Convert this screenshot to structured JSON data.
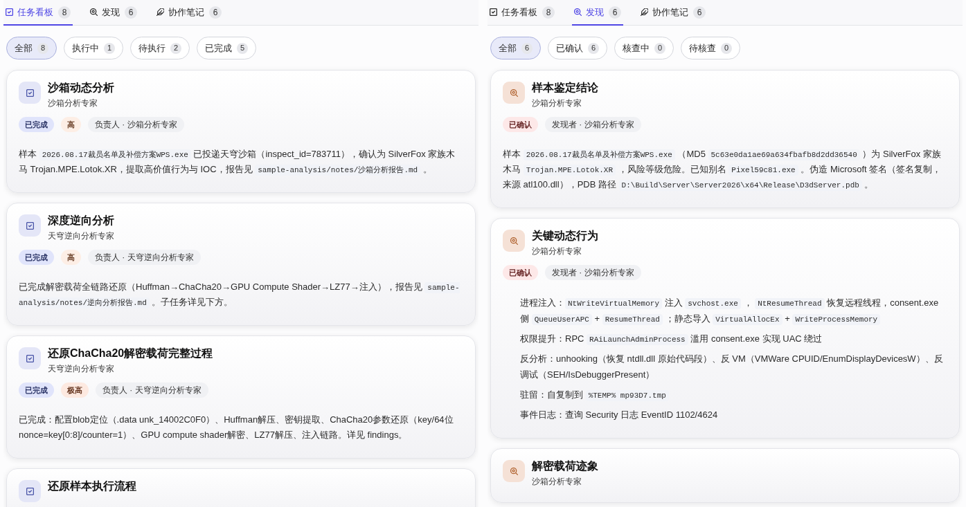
{
  "panels": [
    {
      "tabs": [
        {
          "label": "任务看板",
          "count": "8",
          "selected": true
        },
        {
          "label": "发现",
          "count": "6",
          "selected": false
        },
        {
          "label": "协作笔记",
          "count": "6",
          "selected": false
        }
      ],
      "filters": [
        {
          "label": "全部",
          "count": "8",
          "selected": true
        },
        {
          "label": "执行中",
          "count": "1",
          "selected": false
        },
        {
          "label": "待执行",
          "count": "2",
          "selected": false
        },
        {
          "label": "已完成",
          "count": "5",
          "selected": false
        }
      ],
      "cards": [
        {
          "kind": "task",
          "title": "沙箱动态分析",
          "subtitle": "沙箱分析专家",
          "tags": [
            {
              "kind": "status",
              "text": "已完成",
              "color": "#e0e4fb"
            },
            {
              "kind": "priority",
              "text": "高",
              "color": "#fdeee5"
            },
            {
              "kind": "person",
              "text": "负责人 · 沙箱分析专家"
            }
          ],
          "body": {
            "kind": "paragraph",
            "paragraphs": [
              [
                {
                  "kind": "text",
                  "text": "样本 "
                },
                {
                  "kind": "code",
                  "text": "2026.08.17裁员名单及补偿方案WPS.exe"
                },
                {
                  "kind": "text",
                  "text": " 已投递天穹沙箱（inspect_id=783711），确认为 SilverFox 家族木马 Trojan.MPE.Lotok.XR，提取高价值行为与 IOC，报告见 "
                },
                {
                  "kind": "code",
                  "text": "sample-analysis/notes/沙箱分析报告.md"
                },
                {
                  "kind": "text",
                  "text": " 。"
                }
              ]
            ]
          }
        },
        {
          "kind": "task",
          "title": "深度逆向分析",
          "subtitle": "天穹逆向分析专家",
          "tags": [
            {
              "kind": "status",
              "text": "已完成",
              "color": "#e0e4fb"
            },
            {
              "kind": "priority",
              "text": "高",
              "color": "#fdeee5"
            },
            {
              "kind": "person",
              "text": "负责人 · 天穹逆向分析专家"
            }
          ],
          "body": {
            "kind": "paragraph",
            "paragraphs": [
              [
                {
                  "kind": "text",
                  "text": "已完成解密载荷全链路还原（Huffman→ChaCha20→GPU Compute Shader→LZ77→注入），报告见 "
                },
                {
                  "kind": "code",
                  "text": "sample-analysis/notes/逆向分析报告.md"
                },
                {
                  "kind": "text",
                  "text": " 。子任务详见下方。"
                }
              ]
            ]
          }
        },
        {
          "kind": "task",
          "title": "还原ChaCha20解密载荷完整过程",
          "subtitle": "天穹逆向分析专家",
          "tags": [
            {
              "kind": "status",
              "text": "已完成",
              "color": "#e0e4fb"
            },
            {
              "kind": "priority",
              "text": "极高",
              "color": "#fde9e0"
            },
            {
              "kind": "person",
              "text": "负责人 · 天穹逆向分析专家"
            }
          ],
          "body": {
            "kind": "paragraph",
            "paragraphs": [
              [
                {
                  "kind": "text",
                  "text": "已完成：配置blob定位（.data unk_14002C0F0）、Huffman解压、密钥提取、ChaCha20参数还原（key/64位 nonce=key[0:8]/counter=1）、GPU compute shader解密、LZ77解压、注入链路。详见 findings。"
                }
              ]
            ]
          }
        },
        {
          "kind": "task",
          "title": "还原样本执行流程"
        }
      ]
    },
    {
      "tabs": [
        {
          "label": "任务看板",
          "count": "8",
          "selected": false
        },
        {
          "label": "发现",
          "count": "6",
          "selected": true
        },
        {
          "label": "协作笔记",
          "count": "6",
          "selected": false
        }
      ],
      "filters": [
        {
          "label": "全部",
          "count": "6",
          "selected": true
        },
        {
          "label": "已确认",
          "count": "6",
          "selected": false
        },
        {
          "label": "核查中",
          "count": "0",
          "selected": false
        },
        {
          "label": "待核查",
          "count": "0",
          "selected": false
        }
      ],
      "cards": [
        {
          "kind": "finding",
          "title": "样本鉴定结论",
          "subtitle": "沙箱分析专家",
          "tags": [
            {
              "kind": "status",
              "text": "已确认",
              "color": "#fde8e8"
            },
            {
              "kind": "person",
              "text": "发现者 · 沙箱分析专家"
            }
          ],
          "body": {
            "kind": "paragraph",
            "paragraphs": [
              [
                {
                  "kind": "text",
                  "text": "样本 "
                },
                {
                  "kind": "code",
                  "text": "2026.08.17裁员名单及补偿方案WPS.exe"
                },
                {
                  "kind": "text",
                  "text": " （MD5 "
                },
                {
                  "kind": "code",
                  "text": "5c63e0da1ae69a634fbafb8d2dd36540"
                },
                {
                  "kind": "text",
                  "text": " ）为 SilverFox 家族木马 "
                },
                {
                  "kind": "code",
                  "text": "Trojan.MPE.Lotok.XR"
                },
                {
                  "kind": "text",
                  "text": " ，风险等级危险。已知别名 "
                },
                {
                  "kind": "code",
                  "text": "Pixel59c81.exe"
                },
                {
                  "kind": "text",
                  "text": " 。伪造 Microsoft 签名（签名复制，来源 atl100.dll），PDB 路径 "
                },
                {
                  "kind": "code",
                  "text": "D:\\Build\\Server\\Server2026\\x64\\Release\\D3dServer.pdb"
                },
                {
                  "kind": "text",
                  "text": " 。"
                }
              ]
            ]
          }
        },
        {
          "kind": "finding",
          "title": "关键动态行为",
          "subtitle": "沙箱分析专家",
          "tags": [
            {
              "kind": "status",
              "text": "已确认",
              "color": "#fde8e8"
            },
            {
              "kind": "person",
              "text": "发现者 · 沙箱分析专家"
            }
          ],
          "body": {
            "kind": "list",
            "paragraphs": [
              [
                {
                  "kind": "text",
                  "text": "进程注入："
                },
                {
                  "kind": "code",
                  "text": "NtWriteVirtualMemory"
                },
                {
                  "kind": "text",
                  "text": " 注入 "
                },
                {
                  "kind": "code",
                  "text": "svchost.exe"
                },
                {
                  "kind": "text",
                  "text": " ， "
                },
                {
                  "kind": "code",
                  "text": "NtResumeThread"
                },
                {
                  "kind": "text",
                  "text": " 恢复远程线程，consent.exe 侧 "
                },
                {
                  "kind": "code",
                  "text": "QueueUserAPC"
                },
                {
                  "kind": "text",
                  "text": " + "
                },
                {
                  "kind": "code",
                  "text": "ResumeThread"
                },
                {
                  "kind": "text",
                  "text": " ；静态导入 "
                },
                {
                  "kind": "code",
                  "text": "VirtualAllocEx"
                },
                {
                  "kind": "text",
                  "text": " + "
                },
                {
                  "kind": "code",
                  "text": "WriteProcessMemory"
                }
              ],
              [
                {
                  "kind": "text",
                  "text": "权限提升：RPC "
                },
                {
                  "kind": "code",
                  "text": "RAiLaunchAdminProcess"
                },
                {
                  "kind": "text",
                  "text": " 滥用 consent.exe 实现 UAC 绕过"
                }
              ],
              [
                {
                  "kind": "text",
                  "text": "反分析：unhooking（恢复 ntdll.dll 原始代码段）、反 VM（VMWare CPUID/EnumDisplayDevicesW）、反调试（SEH/IsDebuggerPresent）"
                }
              ],
              [
                {
                  "kind": "text",
                  "text": "驻留：自复制到 "
                },
                {
                  "kind": "code",
                  "text": "%TEMP% mp93D7.tmp"
                }
              ],
              [
                {
                  "kind": "text",
                  "text": "事件日志：查询 Security 日志 EventID 1102/4624"
                }
              ]
            ]
          }
        },
        {
          "kind": "finding",
          "title": "解密载荷迹象",
          "subtitle": "沙箱分析专家"
        }
      ]
    }
  ]
}
